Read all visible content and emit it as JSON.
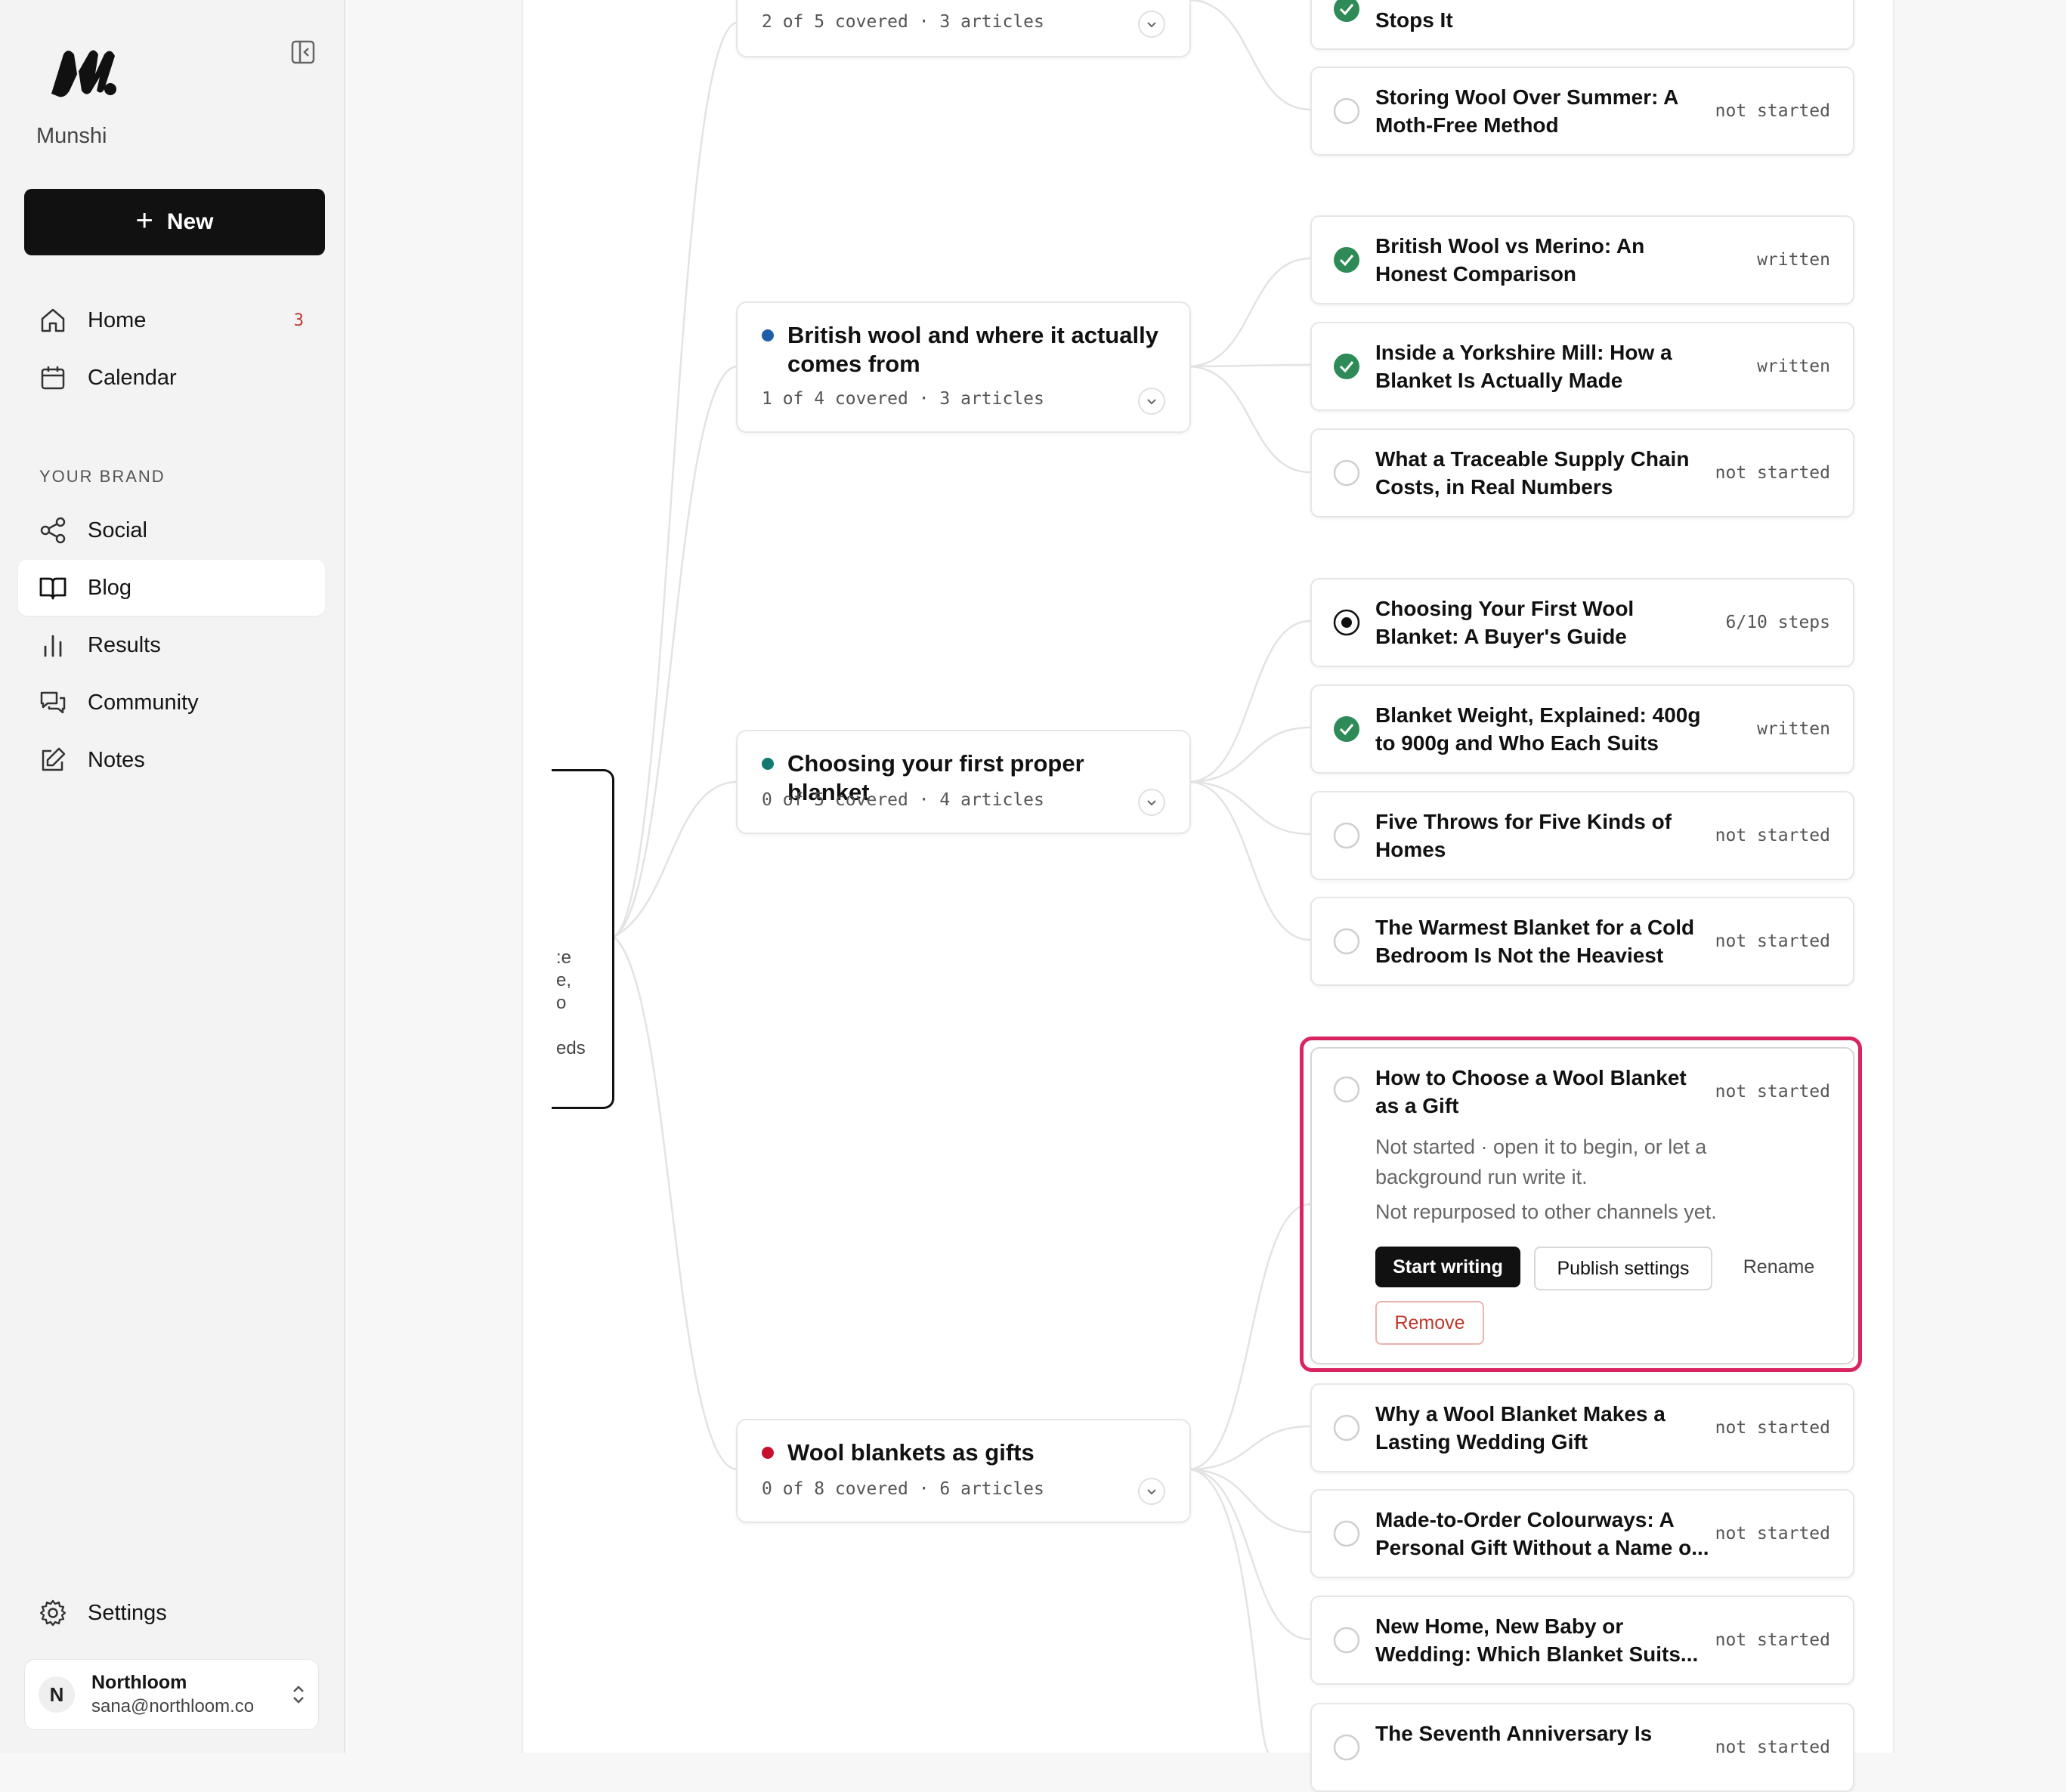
{
  "app": {
    "name": "Munshi"
  },
  "sidebar": {
    "new_label": "New",
    "nav": [
      {
        "label": "Home",
        "icon": "home-icon",
        "badge": "3"
      },
      {
        "label": "Calendar",
        "icon": "calendar-icon"
      }
    ],
    "section_label": "YOUR BRAND",
    "brand_nav": [
      {
        "label": "Social",
        "icon": "share-icon"
      },
      {
        "label": "Blog",
        "icon": "book-icon",
        "active": true
      },
      {
        "label": "Results",
        "icon": "bar-chart-icon"
      },
      {
        "label": "Community",
        "icon": "chat-icon"
      },
      {
        "label": "Notes",
        "icon": "edit-icon"
      }
    ],
    "settings_label": "Settings",
    "account": {
      "initial": "N",
      "name": "Northloom",
      "email": "sana@northloom.co"
    }
  },
  "root_fragments": [
    ":e",
    "e,",
    "o",
    "eds"
  ],
  "topics": [
    {
      "title": "",
      "meta": "2 of 5 covered · 3 articles",
      "dot_color": ""
    },
    {
      "title": "British wool and where it actually comes from",
      "meta": "1 of 4 covered · 3 articles",
      "dot_color": "#1f5fa8"
    },
    {
      "title": "Choosing your first proper blanket",
      "meta": "0 of 5 covered · 4 articles",
      "dot_color": "#127a6e"
    },
    {
      "title": "Wool blankets as gifts",
      "meta": "0 of 8 covered · 6 articles",
      "dot_color": "#c8102e"
    }
  ],
  "articles": [
    {
      "title": "Stops It",
      "status": "written",
      "state": "done"
    },
    {
      "title": "Storing Wool Over Summer: A Moth-Free Method",
      "status": "not started",
      "state": "empty"
    },
    {
      "title": "British Wool vs Merino: An Honest Comparison",
      "status": "written",
      "state": "done"
    },
    {
      "title": "Inside a Yorkshire Mill: How a Blanket Is Actually Made",
      "status": "written",
      "state": "done"
    },
    {
      "title": "What a Traceable Supply Chain Costs, in Real Numbers",
      "status": "not started",
      "state": "empty"
    },
    {
      "title": "Choosing Your First Wool Blanket: A Buyer's Guide",
      "status": "6/10 steps",
      "state": "progress"
    },
    {
      "title": "Blanket Weight, Explained: 400g to 900g and Who Each Suits",
      "status": "written",
      "state": "done"
    },
    {
      "title": "Five Throws for Five Kinds of Homes",
      "status": "not started",
      "state": "empty"
    },
    {
      "title": "The Warmest Blanket for a Cold Bedroom Is Not the Heaviest",
      "status": "not started",
      "state": "empty"
    },
    {
      "title": "Why a Wool Blanket Makes a Lasting Wedding Gift",
      "status": "not started",
      "state": "empty"
    },
    {
      "title": "Made-to-Order Colourways: A Personal Gift Without a Name o...",
      "status": "not started",
      "state": "empty"
    },
    {
      "title": "New Home, New Baby or Wedding: Which Blanket Suits...",
      "status": "not started",
      "state": "empty"
    },
    {
      "title": "The Seventh Anniversary Is",
      "status": "not started",
      "state": "empty"
    }
  ],
  "expanded_article": {
    "title": "How to Choose a Wool Blanket as a Gift",
    "status": "not started",
    "description": "Not started · open it to begin, or let a background run write it.",
    "repurpose_note": "Not repurposed to other channels yet.",
    "actions": {
      "start": "Start writing",
      "publish": "Publish settings",
      "rename": "Rename",
      "remove": "Remove"
    }
  },
  "colors": {
    "accent_focus": "#d9245f",
    "done_green": "#2e8b57",
    "primary": "#111111"
  }
}
